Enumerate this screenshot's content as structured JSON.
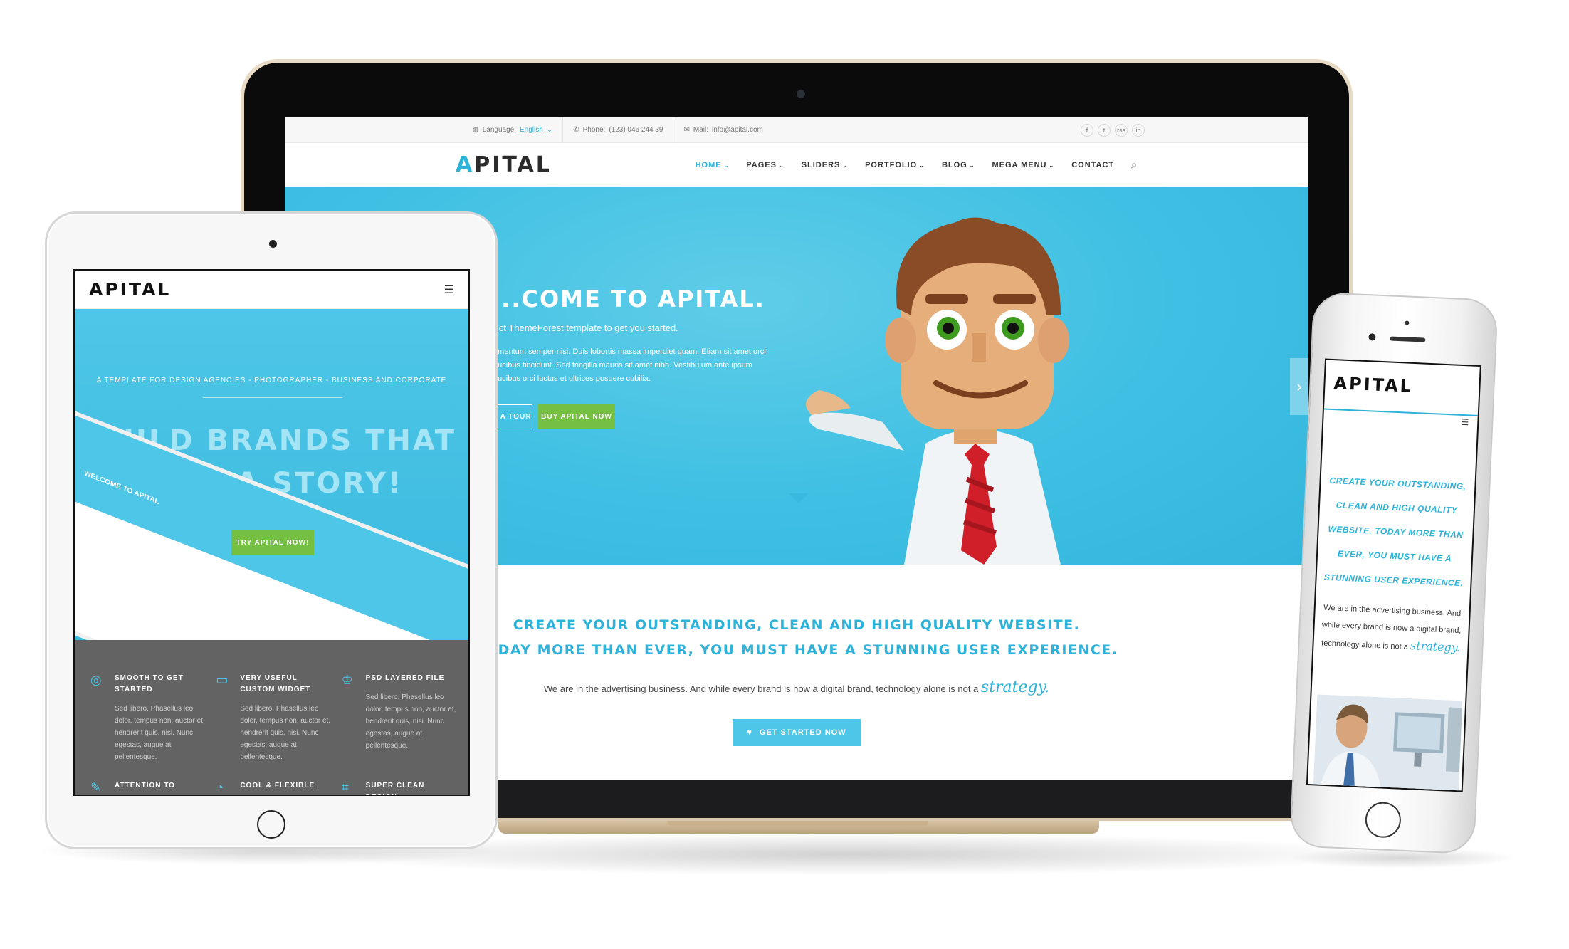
{
  "laptop": {
    "topbar": {
      "language_label": "Language:",
      "language_value": "English",
      "phone_label": "Phone:",
      "phone_value": "(123) 046 244 39",
      "mail_label": "Mail:",
      "mail_value": "info@apital.com",
      "social": [
        "f",
        "t",
        "rss",
        "in"
      ]
    },
    "logo": "APITAL",
    "menu": [
      {
        "label": "HOME",
        "active": true
      },
      {
        "label": "PAGES"
      },
      {
        "label": "SLIDERS"
      },
      {
        "label": "PORTFOLIO"
      },
      {
        "label": "BLOG"
      },
      {
        "label": "MEGA MENU"
      },
      {
        "label": "CONTACT"
      }
    ],
    "hero": {
      "title": "...COME TO APITAL.",
      "subtitle": "...ct ThemeForest template to get you started.",
      "body": "...mentum semper nisi. Duis lobortis massa imperdiet quam. Etiam sit amet orci ...ucibus tincidunt. Sed fringilla mauris sit amet nibh. Vestibulum ante ipsum ...ucibus orci luctus et ultrices posuere cubilia.",
      "tour_label": "E A TOUR",
      "buy_label": "BUY APITAL NOW"
    },
    "content": {
      "heading_line1": "CREATE YOUR OUTSTANDING, CLEAN AND HIGH QUALITY WEBSITE.",
      "heading_line2": "TODAY MORE THAN EVER, YOU MUST HAVE A STUNNING USER EXPERIENCE.",
      "paragraph": "We are in the advertising business. And while every brand is now a digital brand, technology alone is not a",
      "script_word": "strategy.",
      "cta_label": "GET STARTED NOW"
    }
  },
  "tablet": {
    "logo": "APITAL",
    "tagline": "A TEMPLATE FOR DESIGN AGENCIES - PHOTOGRAPHER - BUSINESS AND CORPORATE",
    "headline_line1": "BUILD BRANDS THAT",
    "headline_line2": "TELL A STORY!",
    "try_label": "TRY APITAL NOW!",
    "mock_welcome": "WELCOME TO APITAL",
    "features": [
      {
        "icon": "target-icon",
        "title": "SMOOTH TO GET STARTED",
        "text": "Sed libero. Phasellus leo dolor, tempus non, auctor et, hendrerit quis, nisi. Nunc egestas, augue at pellentesque."
      },
      {
        "icon": "widget-icon",
        "title": "VERY USEFUL CUSTOM WIDGET",
        "text": "Sed libero. Phasellus leo dolor, tempus non, auctor et, hendrerit quis, nisi. Nunc egestas, augue at pellentesque."
      },
      {
        "icon": "layers-icon",
        "title": "PSD LAYERED FILE",
        "text": "Sed libero. Phasellus leo dolor, tempus non, auctor et, hendrerit quis, nisi. Nunc egestas, augue at pellentesque."
      },
      {
        "icon": "pencil-icon",
        "title": "ATTENTION TO",
        "text": ""
      },
      {
        "icon": "gauge-icon",
        "title": "COOL & FLEXIBLE",
        "text": ""
      },
      {
        "icon": "design-icon",
        "title": "SUPER CLEAN DESIGN",
        "text": ""
      }
    ]
  },
  "phone": {
    "logo": "APITAL",
    "heading": "CREATE YOUR OUTSTANDING, CLEAN AND HIGH QUALITY WEBSITE. TODAY MORE THAN EVER, YOU MUST HAVE A STUNNING USER EXPERIENCE.",
    "paragraph": "We are in the advertising business. And while every brand is now a digital brand, technology alone is not a",
    "script_word": "strategy."
  },
  "colors": {
    "accent": "#2db2d9",
    "hero_blue": "#3ebfe3",
    "green": "#75c043",
    "features_gray": "#636363"
  }
}
